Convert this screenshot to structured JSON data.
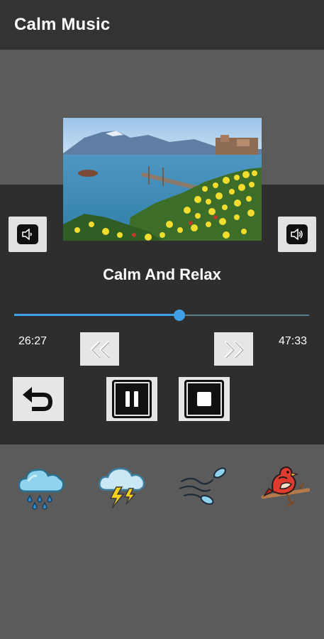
{
  "app_bar": {
    "title": "Calm Music"
  },
  "player": {
    "track_title": "Calm And Relax",
    "current_time": "26:27",
    "total_time": "47:33",
    "progress": 0.56
  },
  "controls": {
    "volume_down_icon": "volume-down-icon",
    "volume_up_icon": "volume-up-icon",
    "rewind_icon": "rewind-icon",
    "fast_forward_icon": "fast-forward-icon",
    "replay_icon": "replay-icon",
    "pause_icon": "pause-icon",
    "stop_icon": "stop-icon"
  },
  "sounds": [
    {
      "icon": "rain-cloud-icon"
    },
    {
      "icon": "thunderstorm-icon"
    },
    {
      "icon": "wind-leaves-icon"
    },
    {
      "icon": "bird-on-branch-icon"
    }
  ],
  "colors": {
    "app_bar": "#333333",
    "background": "#5b5b5b",
    "panel": "#2e2e2e",
    "accent": "#3ea1e6",
    "button_bg": "#e6e6e6"
  }
}
